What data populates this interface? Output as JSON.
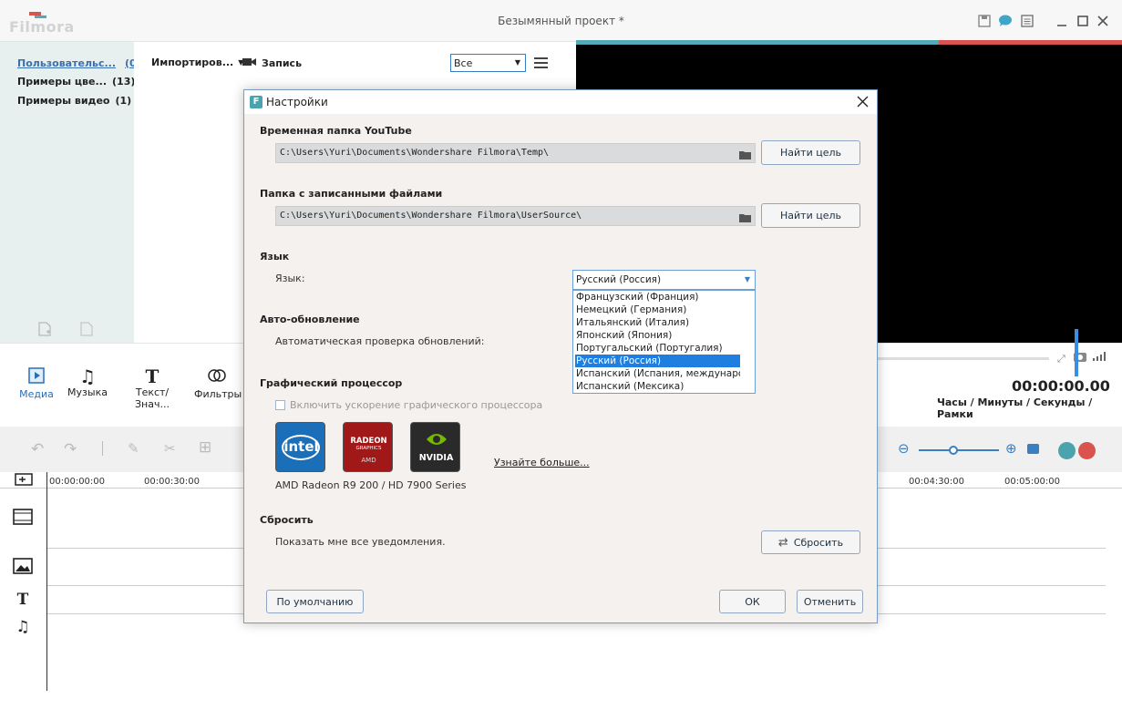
{
  "app": {
    "logo_text": "Filmora",
    "window_title": "Безымянный проект *"
  },
  "media_panel": {
    "sidebar": [
      {
        "label": "Пользовательс...",
        "count": "(0)"
      },
      {
        "label": "Примеры цве...",
        "count": "(13)"
      },
      {
        "label": "Примеры видео",
        "count": "(1)"
      }
    ],
    "import_label": "Импортиров...",
    "record_label": "Запись",
    "filter_value": "Все"
  },
  "tabs": [
    "Медиа",
    "Музыка",
    "Текст/Знач...",
    "Фильтры"
  ],
  "preview": {
    "timecode": "00:00:00.00",
    "units": "Часы / Минуты / Секунды / Рамки"
  },
  "ruler": [
    "00:00:00:00",
    "00:00:30:00",
    "00:04:30:00",
    "00:05:00:00"
  ],
  "dialog": {
    "title": "Настройки",
    "youtube_section": "Временная папка YouTube",
    "youtube_path": "C:\\Users\\Yuri\\Documents\\Wondershare Filmora\\Temp\\",
    "recorded_section": "Папка с записанными файлами",
    "recorded_path": "C:\\Users\\Yuri\\Documents\\Wondershare Filmora\\UserSource\\",
    "browse_label": "Найти цель",
    "lang_section": "Язык",
    "lang_label": "Язык:",
    "lang_selected": "Русский (Россия)",
    "lang_options": [
      "Французский (Франция)",
      "Немецкий (Германия)",
      "Итальянский (Италия)",
      "Японский (Япония)",
      "Португальский (Португалия)",
      "Русский (Россия)",
      "Испанский (Испания, международ",
      "Испанский (Мексика)"
    ],
    "lang_selected_index": 5,
    "auto_update_section": "Авто-обновление",
    "auto_update_label": "Автоматическая проверка обновлений:",
    "gpu_section": "Графический процессор",
    "gpu_checkbox_label": "Включить ускорение графического процессора",
    "gpu_checkbox_checked": false,
    "gpu_logos": {
      "intel": "intel",
      "radeon": "RADEON",
      "radeon_sub": "GRAPHICS",
      "radeon_amd": "AMD",
      "nvidia": "NVIDIA"
    },
    "learn_more": "Узнайте больше...",
    "gpu_model": "AMD Radeon R9 200 / HD 7900 Series",
    "reset_section": "Сбросить",
    "reset_label": "Показать мне все уведомления.",
    "reset_button": "Сбросить",
    "default_button": "По умолчанию",
    "ok_button": "ОК",
    "cancel_button": "Отменить"
  },
  "colors": {
    "accent": "#53a9b6",
    "selection": "#1e7fe0",
    "danger": "#d9534f"
  }
}
